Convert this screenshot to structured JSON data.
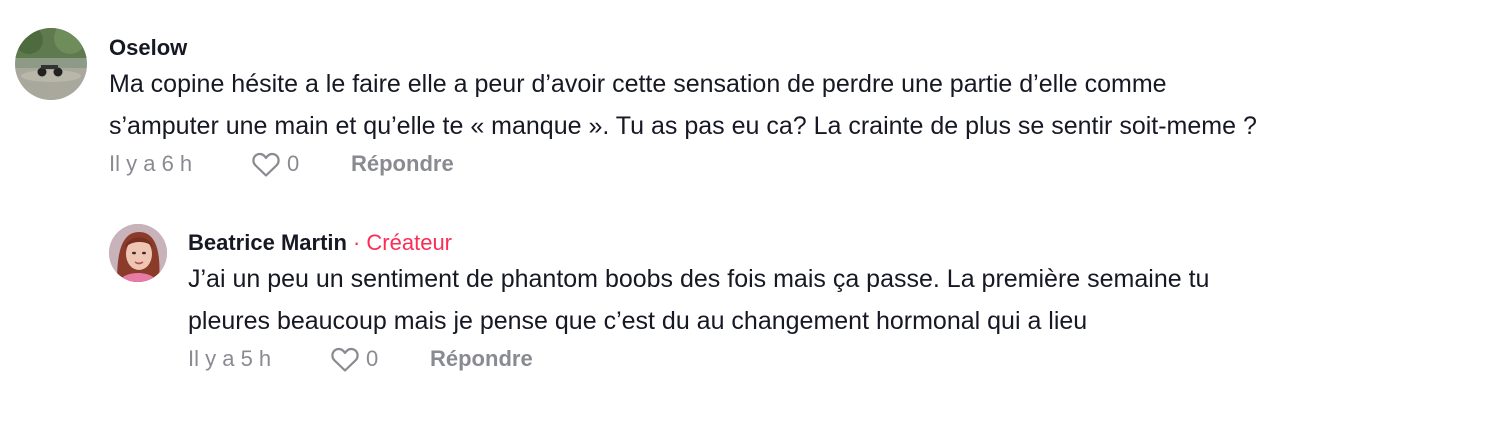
{
  "comments": [
    {
      "username": "Oselow",
      "text": "Ma copine hésite a le faire elle a peur d’avoir cette sensation de perdre une partie d’elle comme\ns’amputer une main et qu’elle te « manque ». Tu as pas eu ca? La crainte de plus se sentir soit-meme ?",
      "time": "Il y a 6 h",
      "likes": "0",
      "reply_label": "Répondre"
    },
    {
      "username": "Beatrice Martin",
      "separator": "·",
      "badge": "Créateur",
      "text": "J’ai un peu un sentiment de phantom boobs des fois mais ça passe. La première semaine tu\npleures beaucoup mais je pense que c’est du au changement hormonal qui a lieu",
      "time": "Il y a 5 h",
      "likes": "0",
      "reply_label": "Répondre"
    }
  ],
  "colors": {
    "text": "#161823",
    "muted": "#8a8b91",
    "creator": "#fe2c55"
  },
  "icons": {
    "like": "heart-outline-icon"
  }
}
